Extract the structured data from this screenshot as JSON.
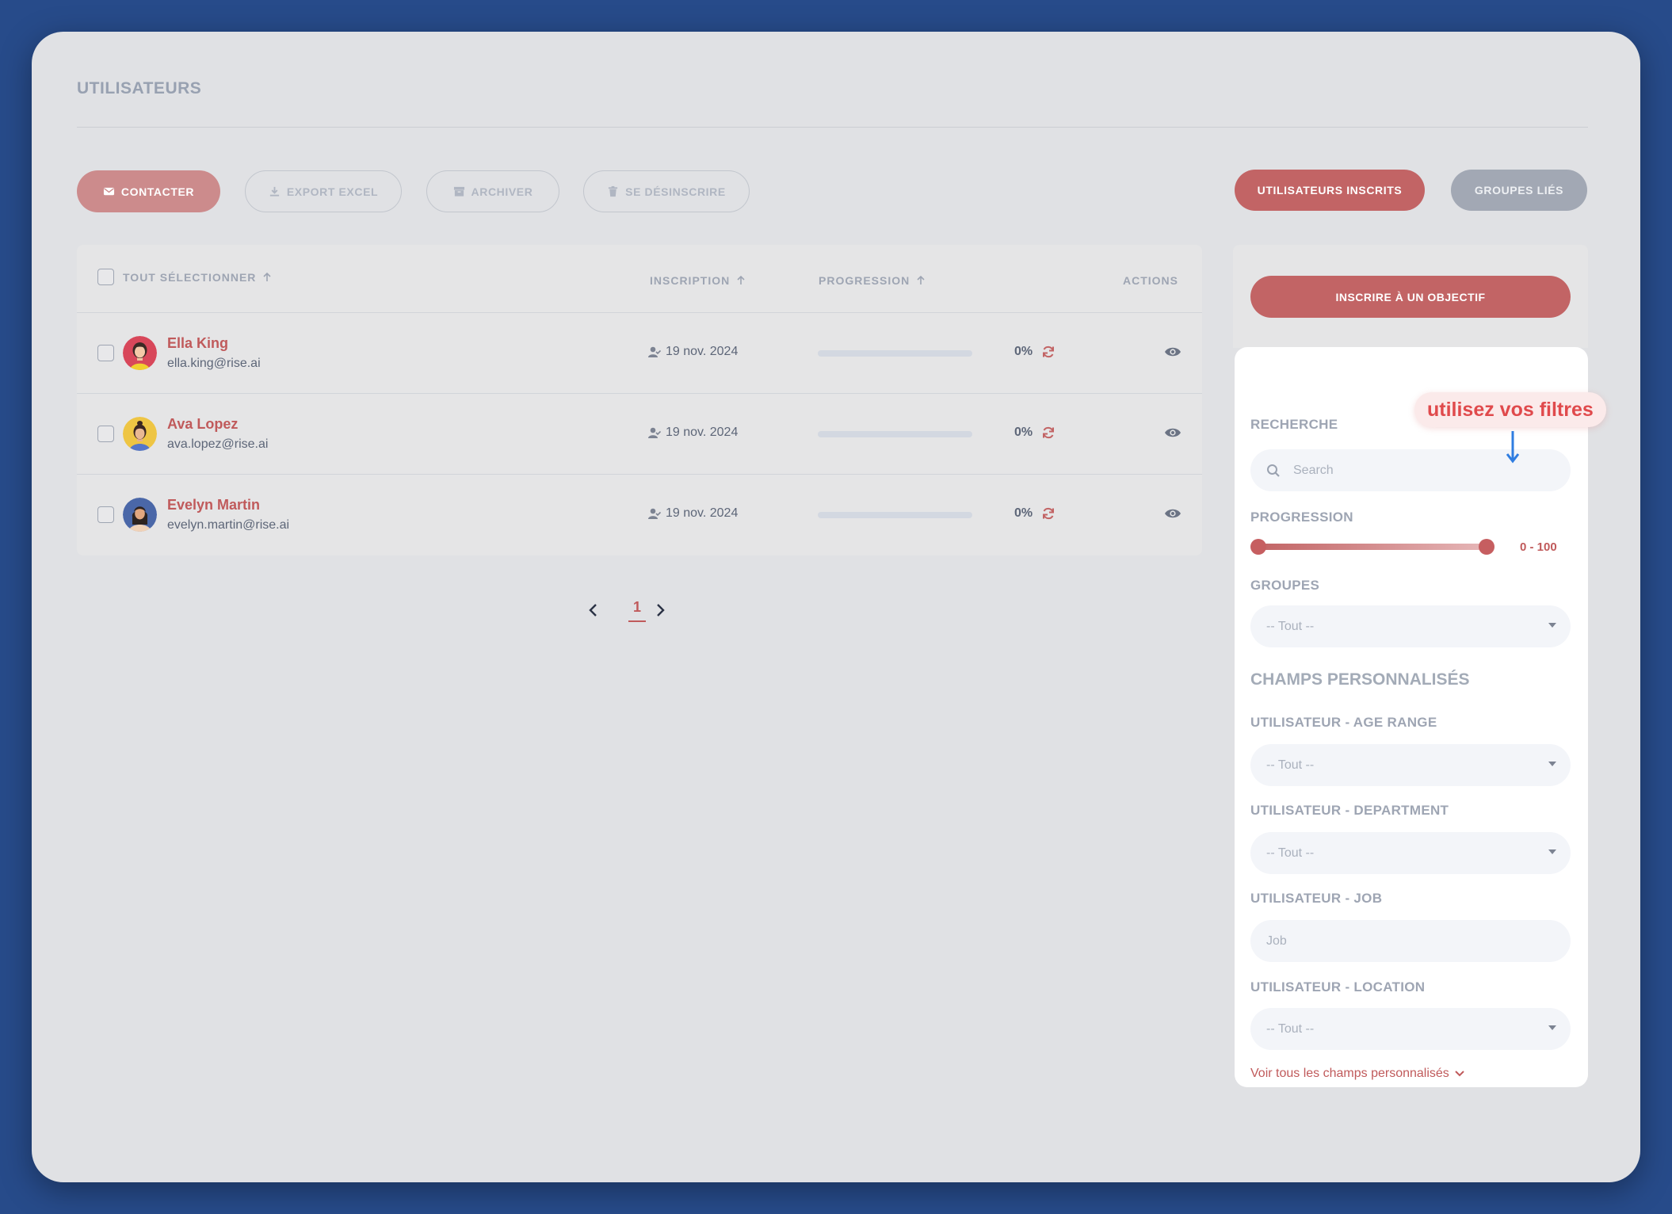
{
  "page": {
    "title": "UTILISATEURS"
  },
  "toolbar": {
    "contact": "CONTACTER",
    "export": "EXPORT EXCEL",
    "archive": "ARCHIVER",
    "unsubscribe": "SE DÉSINSCRIRE",
    "enrolled_users": "UTILISATEURS INSCRITS",
    "linked_groups": "GROUPES LIÉS"
  },
  "table": {
    "headers": {
      "select_all": "TOUT SÉLECTIONNER",
      "enrollment": "INSCRIPTION",
      "progress": "PROGRESSION",
      "actions": "ACTIONS"
    },
    "rows": [
      {
        "name": "Ella King",
        "email": "ella.king@rise.ai",
        "date": "19 nov. 2024",
        "progress_label": "0%",
        "progress": 0
      },
      {
        "name": "Ava Lopez",
        "email": "ava.lopez@rise.ai",
        "date": "19 nov. 2024",
        "progress_label": "0%",
        "progress": 0
      },
      {
        "name": "Evelyn Martin",
        "email": "evelyn.martin@rise.ai",
        "date": "19 nov. 2024",
        "progress_label": "0%",
        "progress": 0
      }
    ]
  },
  "pagination": {
    "current": "1"
  },
  "panel": {
    "enroll_goal": "INSCRIRE À UN OBJECTIF",
    "search_label": "RECHERCHE",
    "search_placeholder": "Search",
    "progress_label": "PROGRESSION",
    "progress_range": "0 - 100",
    "groups_label": "GROUPES",
    "groups_value": "-- Tout --",
    "custom_fields_title": "CHAMPS PERSONNALISÉS",
    "age_label": "UTILISATEUR - AGE RANGE",
    "age_value": "-- Tout --",
    "department_label": "UTILISATEUR - DEPARTMENT",
    "department_value": "-- Tout --",
    "job_label": "UTILISATEUR - JOB",
    "job_placeholder": "Job",
    "location_label": "UTILISATEUR - LOCATION",
    "location_value": "-- Tout --",
    "see_all": "Voir tous les champs personnalisés"
  },
  "annotation": {
    "tip": "utilisez vos filtres"
  },
  "colors": {
    "accent": "#c26465",
    "name": "#c05a5b",
    "tip": "#e04a4c",
    "arrow": "#2f7de1"
  }
}
